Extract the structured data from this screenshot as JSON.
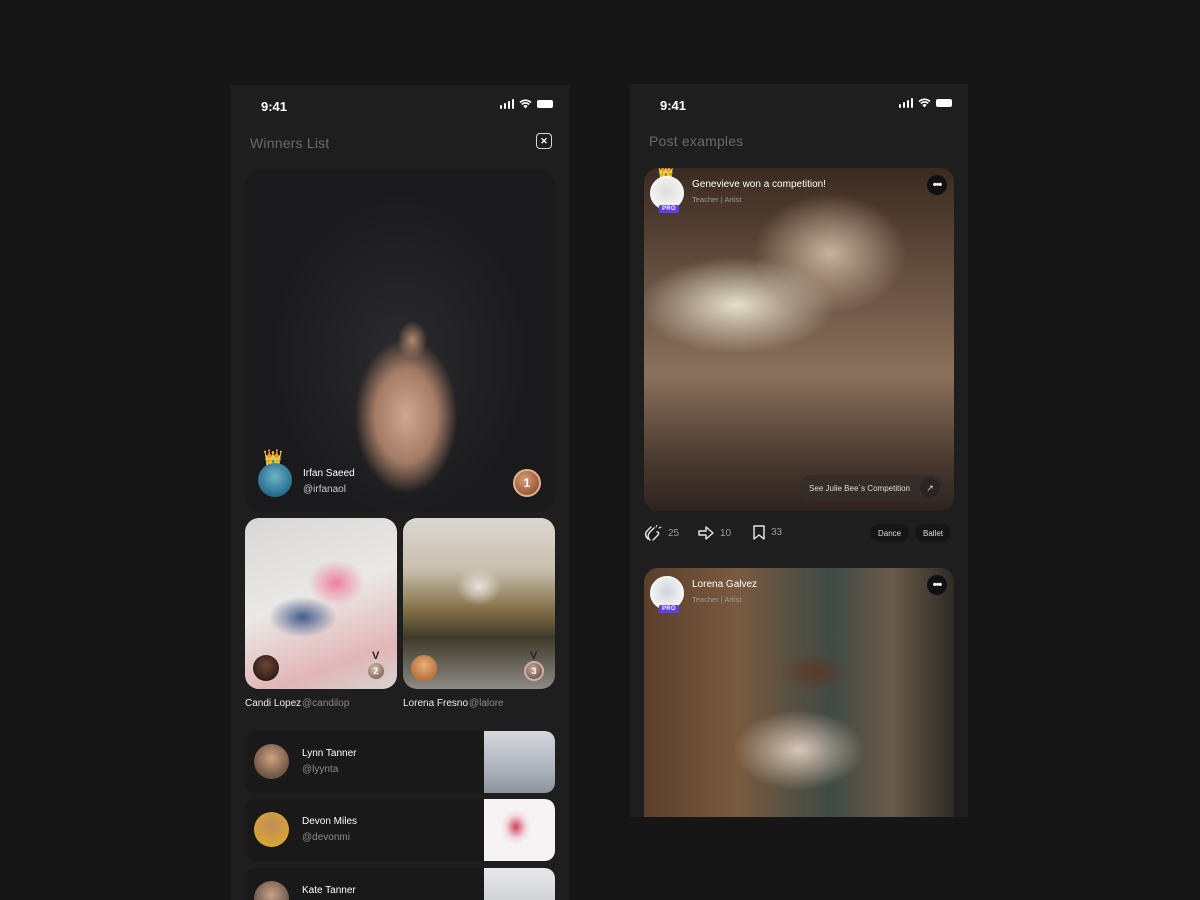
{
  "status": {
    "time": "9:41"
  },
  "winners_screen": {
    "title": "Winners List",
    "close_icon": "close-icon",
    "first": {
      "name": "Irfan Saeed",
      "handle": "@irfanaol",
      "rank": "1",
      "crown": "👑"
    },
    "second": {
      "name": "Candi Lopez",
      "handle": "@candilop",
      "rank": "2"
    },
    "third": {
      "name": "Lorena Fresno",
      "handle": "@lalore",
      "rank": "3"
    },
    "list": [
      {
        "name": "Lynn Tanner",
        "handle": "@lyynta"
      },
      {
        "name": "Devon Miles",
        "handle": "@devonmi"
      },
      {
        "name": "Kate Tanner",
        "handle": ""
      }
    ]
  },
  "posts_screen": {
    "title": "Post examples",
    "post1": {
      "title": "Genevieve won a competition!",
      "subtitle": "Teacher | Artist",
      "badge": "PRO",
      "crown": "👑",
      "more": "•••",
      "cta": "See Julie Bee´s Competition",
      "cta_arrow": "↗",
      "claps": "25",
      "shares": "10",
      "saves": "33",
      "tags": [
        "Dance",
        "Ballet"
      ]
    },
    "post2": {
      "title": "Lorena Galvez",
      "subtitle": "Teacher | Artist",
      "badge": "PRO",
      "more": "•••"
    }
  }
}
